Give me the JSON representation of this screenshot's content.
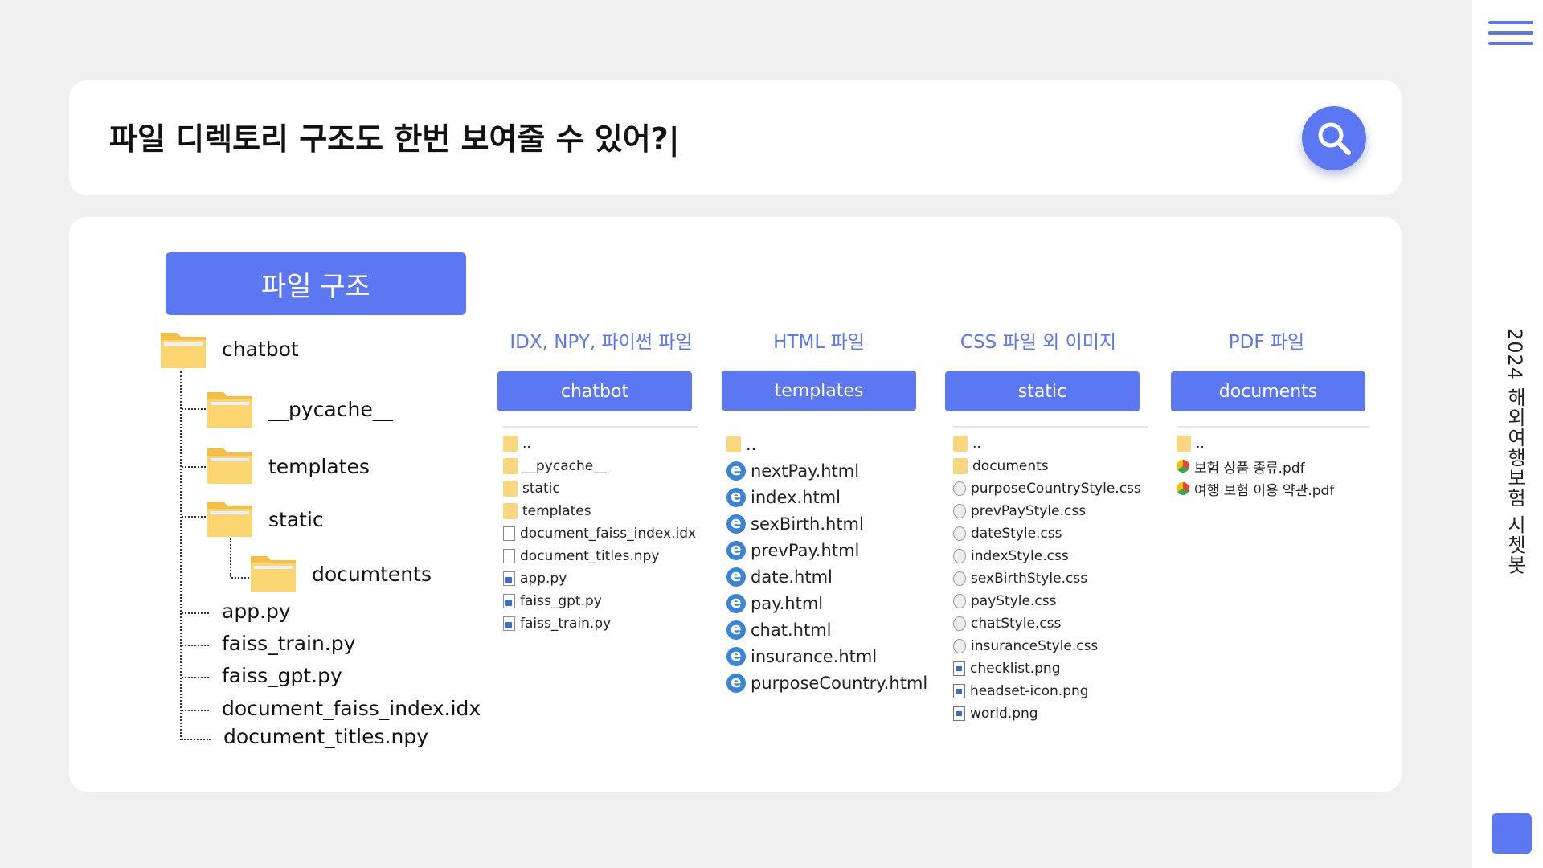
{
  "query": "파일 디렉토리 구조도 한번 보여줄 수 있어?|",
  "sidebar_title": "2024 해외여행보험 시쳇봇",
  "tree_header": "파일 구조",
  "tree": {
    "root": "chatbot",
    "pycache": "__pycache__",
    "templates": "templates",
    "static": "static",
    "documtents": "documtents",
    "app_py": "app.py",
    "faiss_train": "faiss_train.py",
    "faiss_gpt": "faiss_gpt.py",
    "faiss_index": "document_faiss_index.idx",
    "titles_npy": "document_titles.npy"
  },
  "columns": [
    {
      "title": "IDX, NPY, 파이썬 파일",
      "button": "chatbot",
      "items": [
        {
          "name": "..",
          "icon": "folder"
        },
        {
          "name": "__pycache__",
          "icon": "folder"
        },
        {
          "name": "static",
          "icon": "folder"
        },
        {
          "name": "templates",
          "icon": "folder"
        },
        {
          "name": "document_faiss_index.idx",
          "icon": "file"
        },
        {
          "name": "document_titles.npy",
          "icon": "file"
        },
        {
          "name": "app.py",
          "icon": "py"
        },
        {
          "name": "faiss_gpt.py",
          "icon": "py"
        },
        {
          "name": "faiss_train.py",
          "icon": "py"
        }
      ]
    },
    {
      "title": "HTML 파일",
      "button": "templates",
      "items": [
        {
          "name": "..",
          "icon": "folder"
        },
        {
          "name": "nextPay.html",
          "icon": "html"
        },
        {
          "name": "index.html",
          "icon": "html"
        },
        {
          "name": "sexBirth.html",
          "icon": "html"
        },
        {
          "name": "prevPay.html",
          "icon": "html"
        },
        {
          "name": "date.html",
          "icon": "html"
        },
        {
          "name": "pay.html",
          "icon": "html"
        },
        {
          "name": "chat.html",
          "icon": "html"
        },
        {
          "name": "insurance.html",
          "icon": "html"
        },
        {
          "name": "purposeCountry.html",
          "icon": "html"
        }
      ]
    },
    {
      "title": "CSS 파일 외 이미지",
      "button": "static",
      "items": [
        {
          "name": "..",
          "icon": "folder"
        },
        {
          "name": "documents",
          "icon": "folder"
        },
        {
          "name": "purposeCountryStyle.css",
          "icon": "css"
        },
        {
          "name": "prevPayStyle.css",
          "icon": "css"
        },
        {
          "name": "dateStyle.css",
          "icon": "css"
        },
        {
          "name": "indexStyle.css",
          "icon": "css"
        },
        {
          "name": "sexBirthStyle.css",
          "icon": "css"
        },
        {
          "name": "payStyle.css",
          "icon": "css"
        },
        {
          "name": "chatStyle.css",
          "icon": "css"
        },
        {
          "name": "insuranceStyle.css",
          "icon": "css"
        },
        {
          "name": "checklist.png",
          "icon": "png"
        },
        {
          "name": "headset-icon.png",
          "icon": "png"
        },
        {
          "name": "world.png",
          "icon": "png"
        }
      ]
    },
    {
      "title": "PDF 파일",
      "button": "documents",
      "items": [
        {
          "name": "..",
          "icon": "folder"
        },
        {
          "name": "보험 상품 종류.pdf",
          "icon": "pdf"
        },
        {
          "name": "여행 보험 이용 약관.pdf",
          "icon": "pdf"
        }
      ]
    }
  ],
  "colors": {
    "accent": "#5b77f2",
    "folder": "#f9d77e"
  }
}
